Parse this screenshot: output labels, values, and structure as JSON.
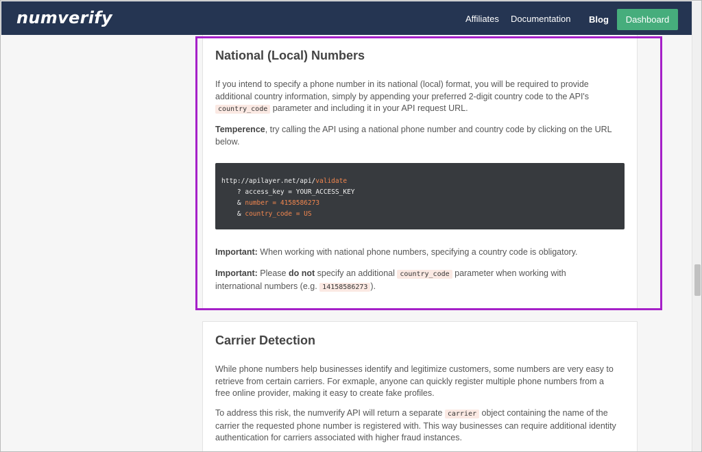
{
  "navbar": {
    "logo": "numverify",
    "links": [
      "Affiliates",
      "Documentation",
      "Blog"
    ],
    "dashboard_label": "Dashboard"
  },
  "section1": {
    "title": "National (Local) Numbers",
    "p1_a": "If you intend to specify a phone number in its national (local) format, you will be required to provide additional country information, simply by appending your preferred 2-digit country code to the API's",
    "p1_code": "country_code",
    "p1_b": "parameter and including it in your API request URL.",
    "p2_bold": "Temperence",
    "p2_text": ", try calling the API using a national phone number and country code by clicking on the URL below.",
    "code": {
      "base": "http://apilayer.net/api/",
      "endpoint": "validate",
      "l2_prefix": "? ",
      "l2_key": "access_key",
      "l2_eq": " = ",
      "l2_val": "YOUR_ACCESS_KEY",
      "l3_prefix": "& ",
      "l3_key": "number",
      "l3_eq": " = ",
      "l3_val": "4158586273",
      "l4_prefix": "& ",
      "l4_key": "country_code",
      "l4_eq": " = ",
      "l4_val": "US"
    },
    "imp1_bold": "Important:",
    "imp1_text": " When working with national phone numbers, specifying a country code is obligatory.",
    "imp2_bold": "Important:",
    "imp2_a": " Please ",
    "imp2_donot": "do not",
    "imp2_b": " specify an additional ",
    "imp2_code": "country_code",
    "imp2_c": " parameter when working with international numbers (e.g. ",
    "imp2_code2": "14158586273",
    "imp2_d": ")."
  },
  "section2": {
    "title": "Carrier Detection",
    "p1": "While phone numbers help businesses identify and legitimize customers, some numbers are very easy to retrieve from certain carriers. For exmaple, anyone can quickly register multiple phone numbers from a free online provider, making it easy to create fake profiles.",
    "p2_a": "To address this risk, the numverify API will return a separate ",
    "p2_code": "carrier",
    "p2_b": " object containing the name of the carrier the requested phone number is registered with. This way businesses can require additional identity authentication for carriers associated with higher fraud instances."
  },
  "colors": {
    "navbar": "#253552",
    "dashboard": "#46ad7c",
    "highlight": "#a520c8",
    "code_bg": "#373a3e",
    "code_accent": "#f3874f"
  }
}
